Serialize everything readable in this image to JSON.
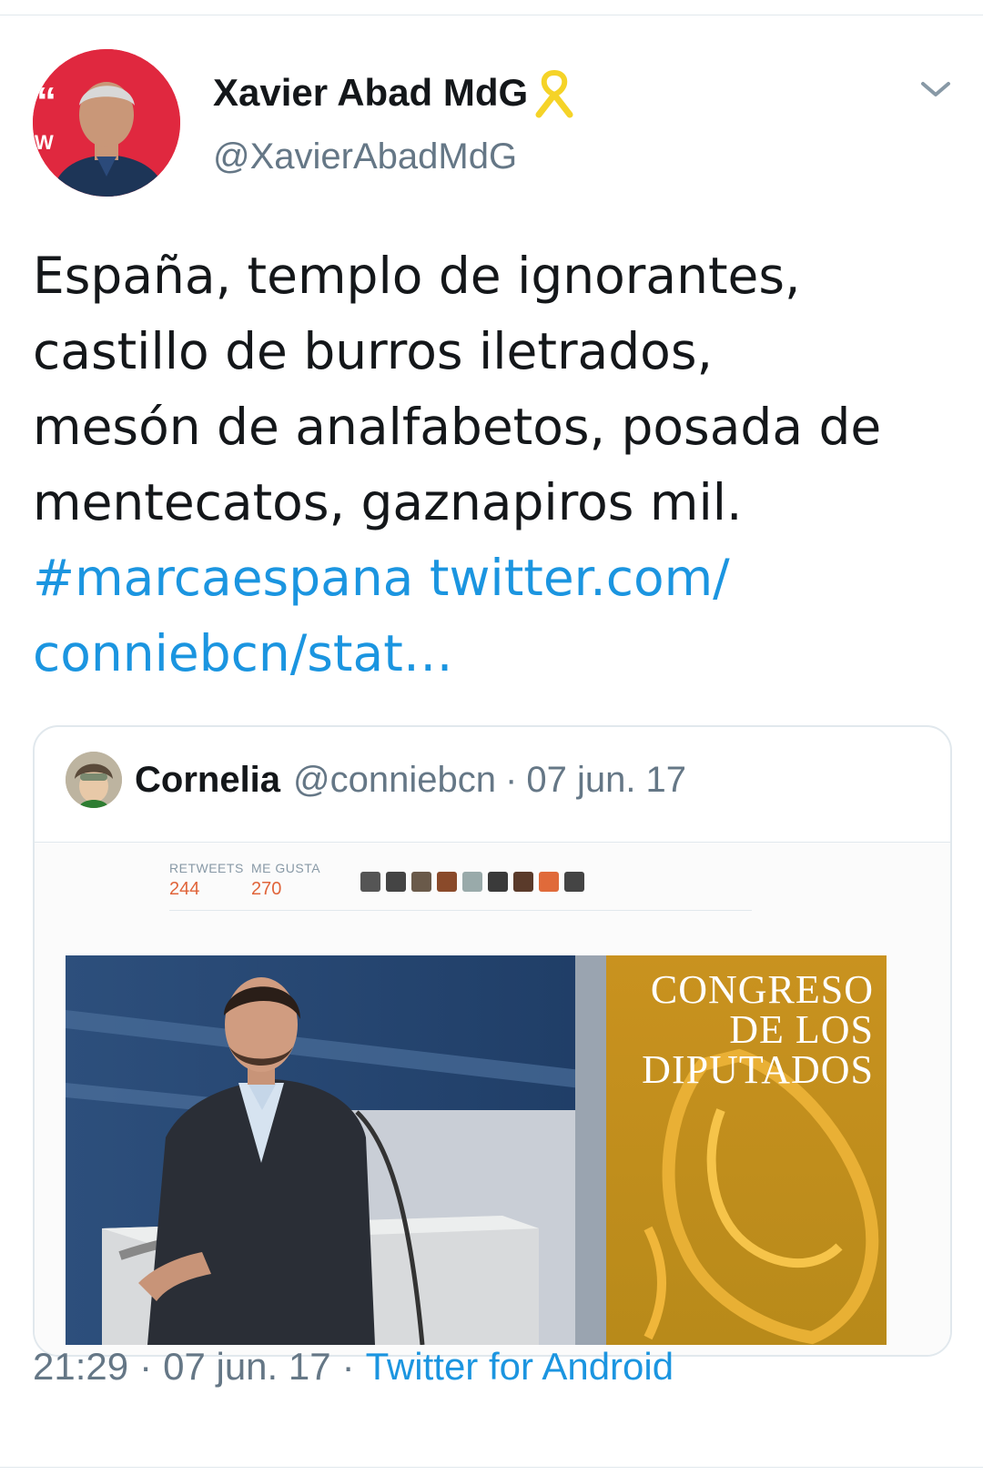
{
  "tweet": {
    "author_name": "Xavier Abad MdG",
    "author_handle": "@XavierAbadMdG",
    "text_lines": [
      "España, templo de ignorantes,",
      "castillo de burros iletrados,",
      "mesón de analfabetos, posada de",
      "mentecatos, gaznapiros mil."
    ],
    "hashtag": "#marcaespana",
    "link_part1": "twitter.com/",
    "link_part2": "conniebcn/stat…",
    "time": "21:29",
    "date": "07 jun. 17",
    "source": "Twitter for Android",
    "separator": "·"
  },
  "quoted": {
    "name": "Cornelia",
    "handle": "@conniebcn",
    "date": "07 jun. 17",
    "separator": "·",
    "embedded_stats": {
      "retweets_label": "RETWEETS",
      "retweets": "244",
      "likes_label": "ME GUSTA",
      "likes": "270"
    },
    "photo_sign_lines": [
      "CONGRESO",
      "DE LOS",
      "DIPUTADOS"
    ]
  },
  "colors": {
    "link": "#1b95e0",
    "secondary_text": "#657786",
    "ribbon": "#f5d328",
    "stats_number": "#e0643a"
  },
  "icons": {
    "ribbon": "yellow-ribbon-icon",
    "chevron": "chevron-down-icon"
  }
}
